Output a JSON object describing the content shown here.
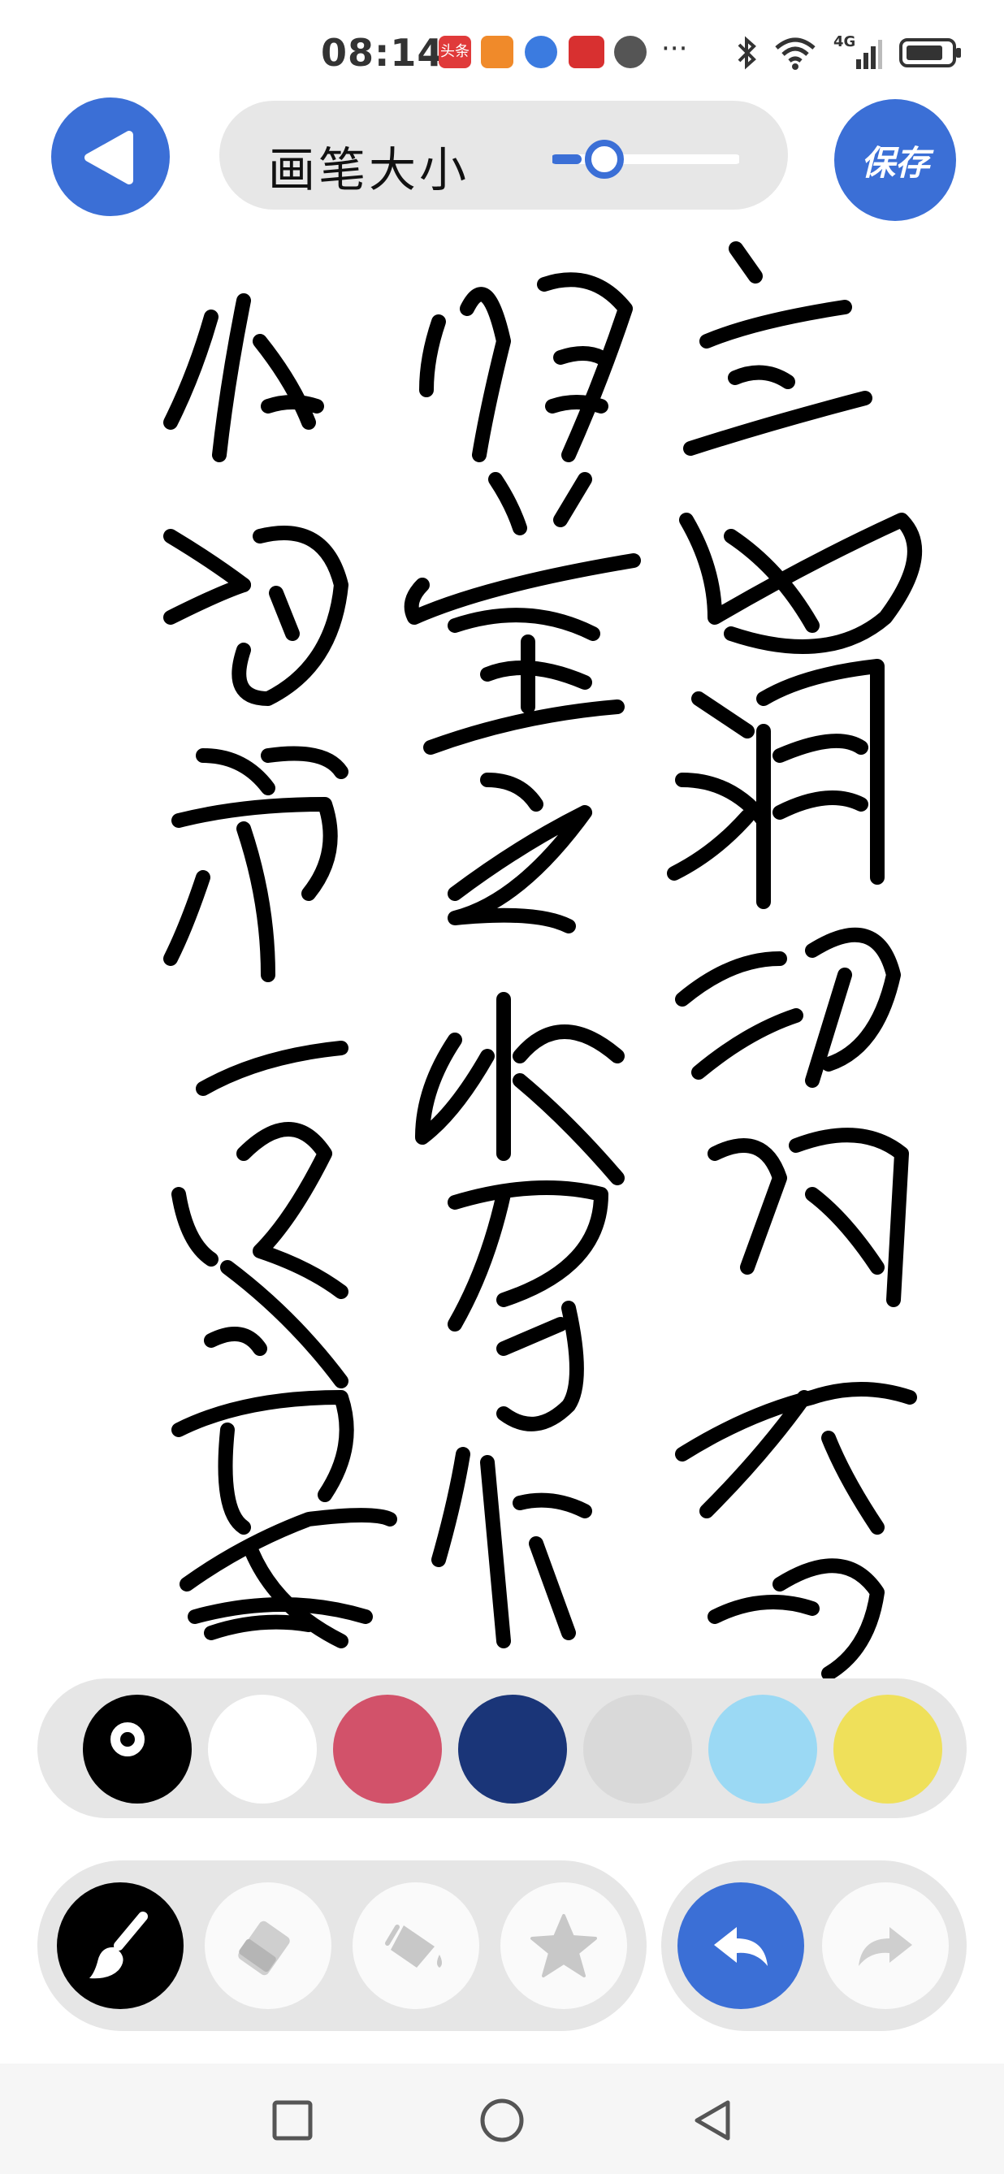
{
  "status_bar": {
    "time": "08:14",
    "network": "4G",
    "icons": [
      "toutiao-icon",
      "redpacket-icon",
      "browser-icon",
      "xuexi-icon",
      "voice-icon",
      "more-icon",
      "bluetooth-icon",
      "wifi-icon",
      "signal-icon",
      "battery-icon"
    ],
    "more": "···"
  },
  "toolbar": {
    "back_icon": "back-arrow-icon",
    "brush_size_label": "画笔大小",
    "brush_size_value": 0.15,
    "save_label": "保存"
  },
  "colors": {
    "accent": "#3b6fd6",
    "ink": "#000000"
  },
  "palette": {
    "swatches": [
      "#000000",
      "#ffffff",
      "#d2526a",
      "#1a3578",
      "#d9d9d9",
      "#9bd9f4",
      "#efe05a"
    ],
    "selected_index": 0
  },
  "tools": {
    "items": [
      "brush-icon",
      "eraser-icon",
      "fill-bucket-icon",
      "star-icon"
    ],
    "selected": "brush-icon"
  },
  "history": {
    "undo_icon": "undo-icon",
    "redo_icon": "redo-icon"
  },
  "navbar": {
    "items": [
      "recents-square-icon",
      "home-circle-icon",
      "back-triangle-icon"
    ]
  }
}
